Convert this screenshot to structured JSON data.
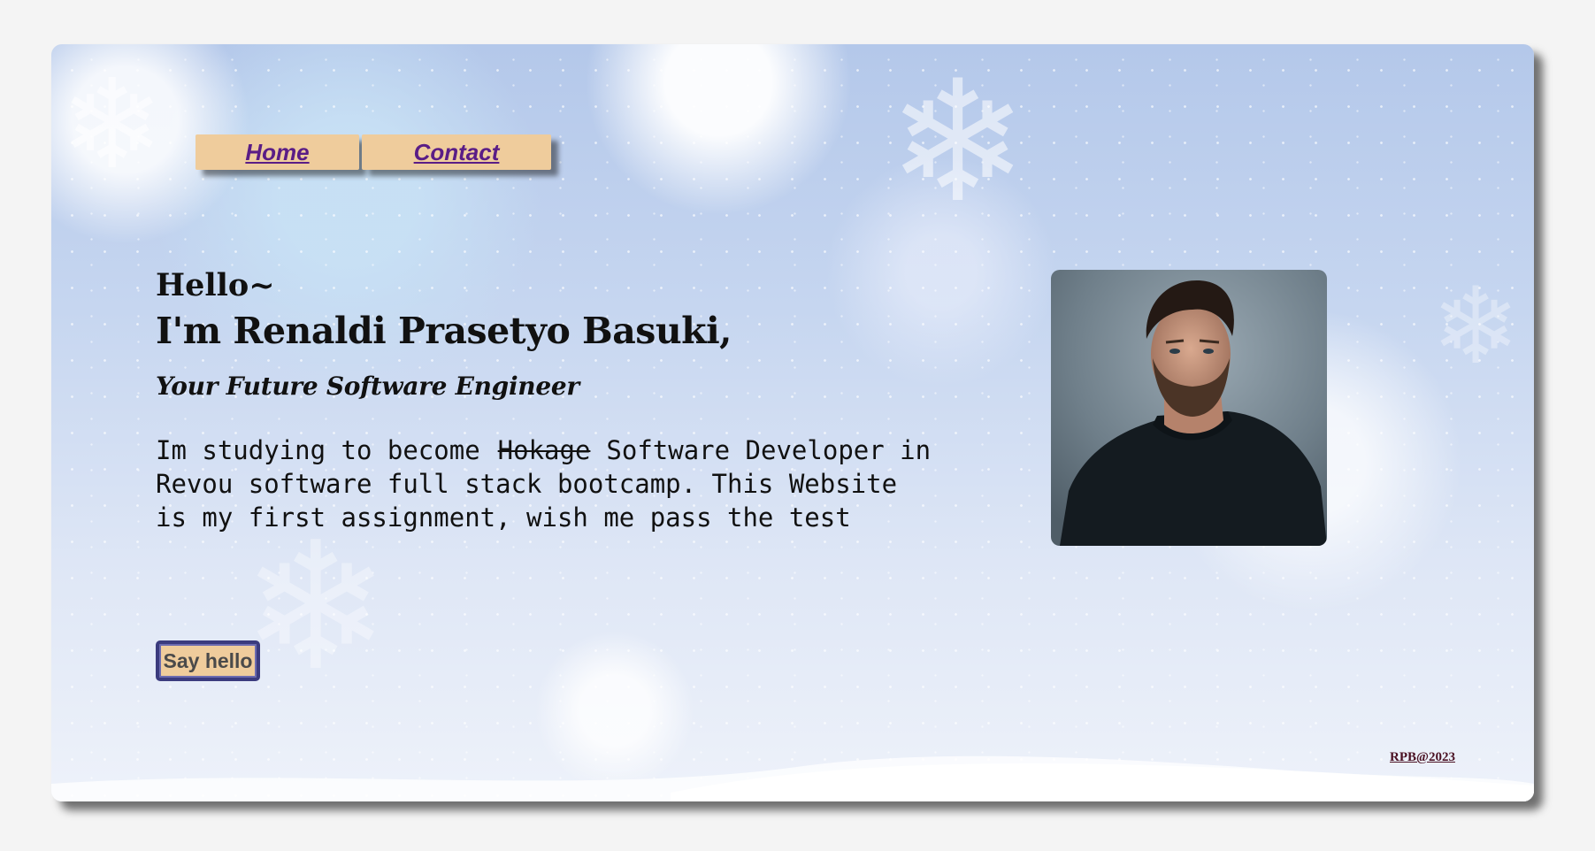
{
  "nav": {
    "home_label": "Home",
    "contact_label": "Contact"
  },
  "hero": {
    "greeting": "Hello~",
    "name": "I'm Renaldi Prasetyo Basuki,",
    "tagline": "Your Future Software Engineer",
    "intro_before": "Im studying to become",
    "intro_struck": "Hokage",
    "intro_after": "Software Developer in Revou software full stack bootcamp. This Website is my first assignment, wish me pass the test",
    "button_label": "Say hello"
  },
  "footer": {
    "credit": "RPB@2023"
  },
  "colors": {
    "nav_button_bg": "#efcc9c",
    "nav_link_text": "#5a1d86",
    "say_hello_border": "#3b3b7e",
    "footer_text": "#4a1022"
  },
  "icons": {
    "background": "snowflake-icon"
  }
}
